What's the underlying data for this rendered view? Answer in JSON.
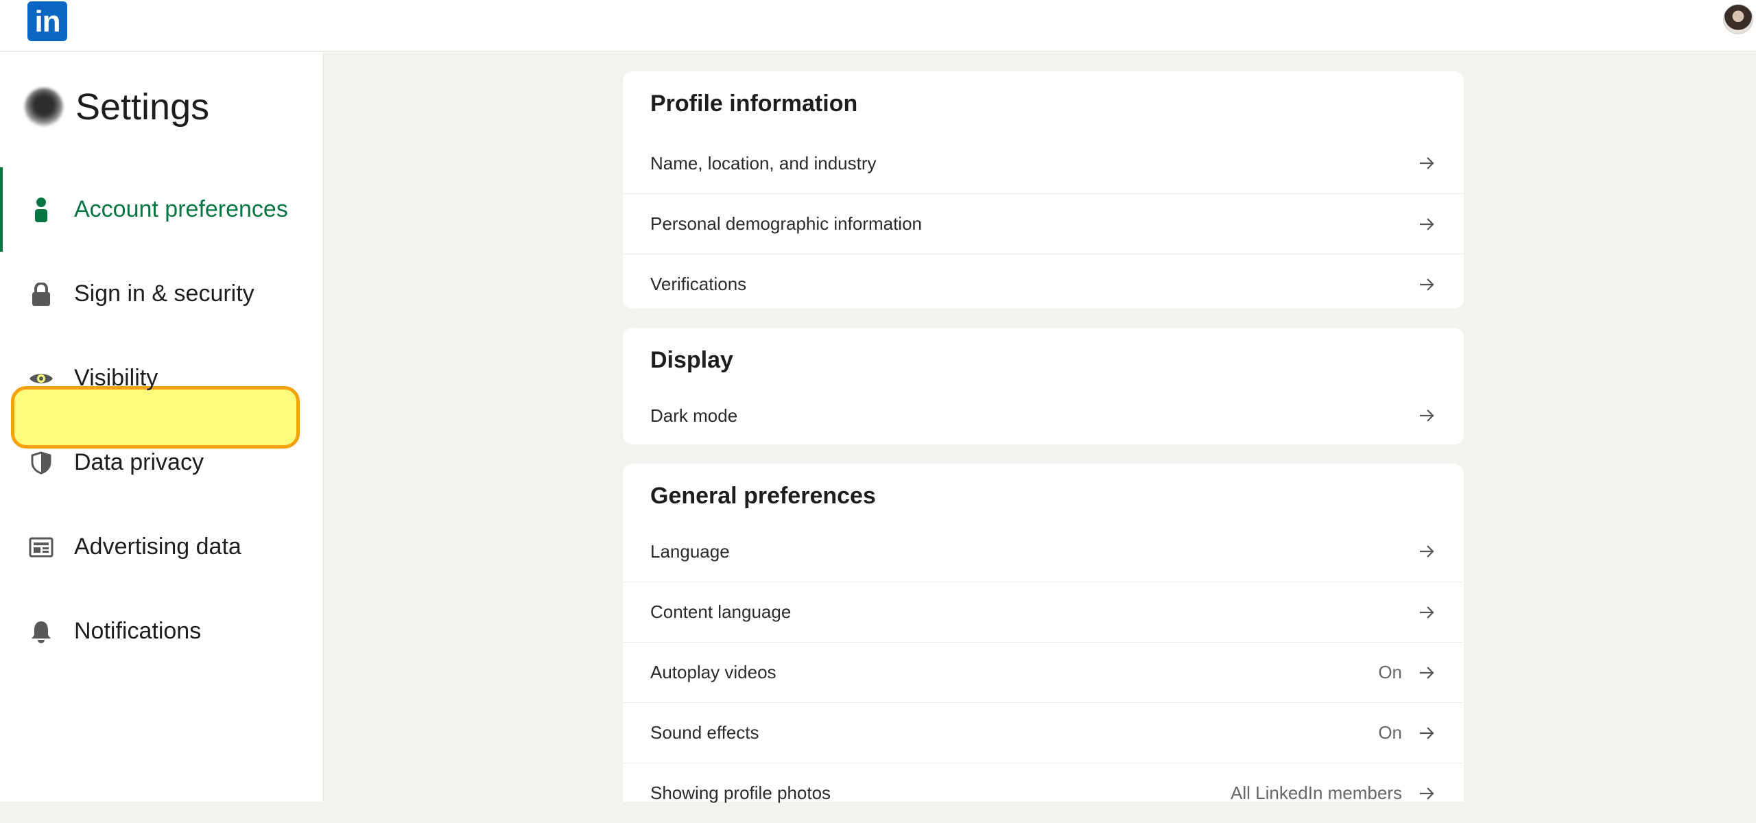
{
  "topbar": {
    "logo_text": "in"
  },
  "sidebar": {
    "title": "Settings",
    "items": [
      {
        "label": "Account preferences",
        "icon": "person-icon"
      },
      {
        "label": "Sign in & security",
        "icon": "lock-icon"
      },
      {
        "label": "Visibility",
        "icon": "eye-icon"
      },
      {
        "label": "Data privacy",
        "icon": "shield-icon"
      },
      {
        "label": "Advertising data",
        "icon": "ad-card-icon"
      },
      {
        "label": "Notifications",
        "icon": "bell-icon"
      }
    ],
    "active_item": "Account preferences",
    "highlighted_item": "Visibility"
  },
  "sections": {
    "profile": {
      "title": "Profile information",
      "rows": [
        {
          "label": "Name, location, and industry",
          "value": ""
        },
        {
          "label": "Personal demographic information",
          "value": ""
        },
        {
          "label": "Verifications",
          "value": ""
        }
      ]
    },
    "display": {
      "title": "Display",
      "rows": [
        {
          "label": "Dark mode",
          "value": ""
        }
      ]
    },
    "general": {
      "title": "General preferences",
      "rows": [
        {
          "label": "Language",
          "value": ""
        },
        {
          "label": "Content language",
          "value": ""
        },
        {
          "label": "Autoplay videos",
          "value": "On"
        },
        {
          "label": "Sound effects",
          "value": "On"
        },
        {
          "label": "Showing profile photos",
          "value": "All LinkedIn members"
        }
      ]
    }
  },
  "colors": {
    "brand": "#0a66c2",
    "active": "#057642",
    "highlight_fill": "#fdfb7c",
    "highlight_border": "#f5a10a",
    "background": "#f3f2ef"
  }
}
